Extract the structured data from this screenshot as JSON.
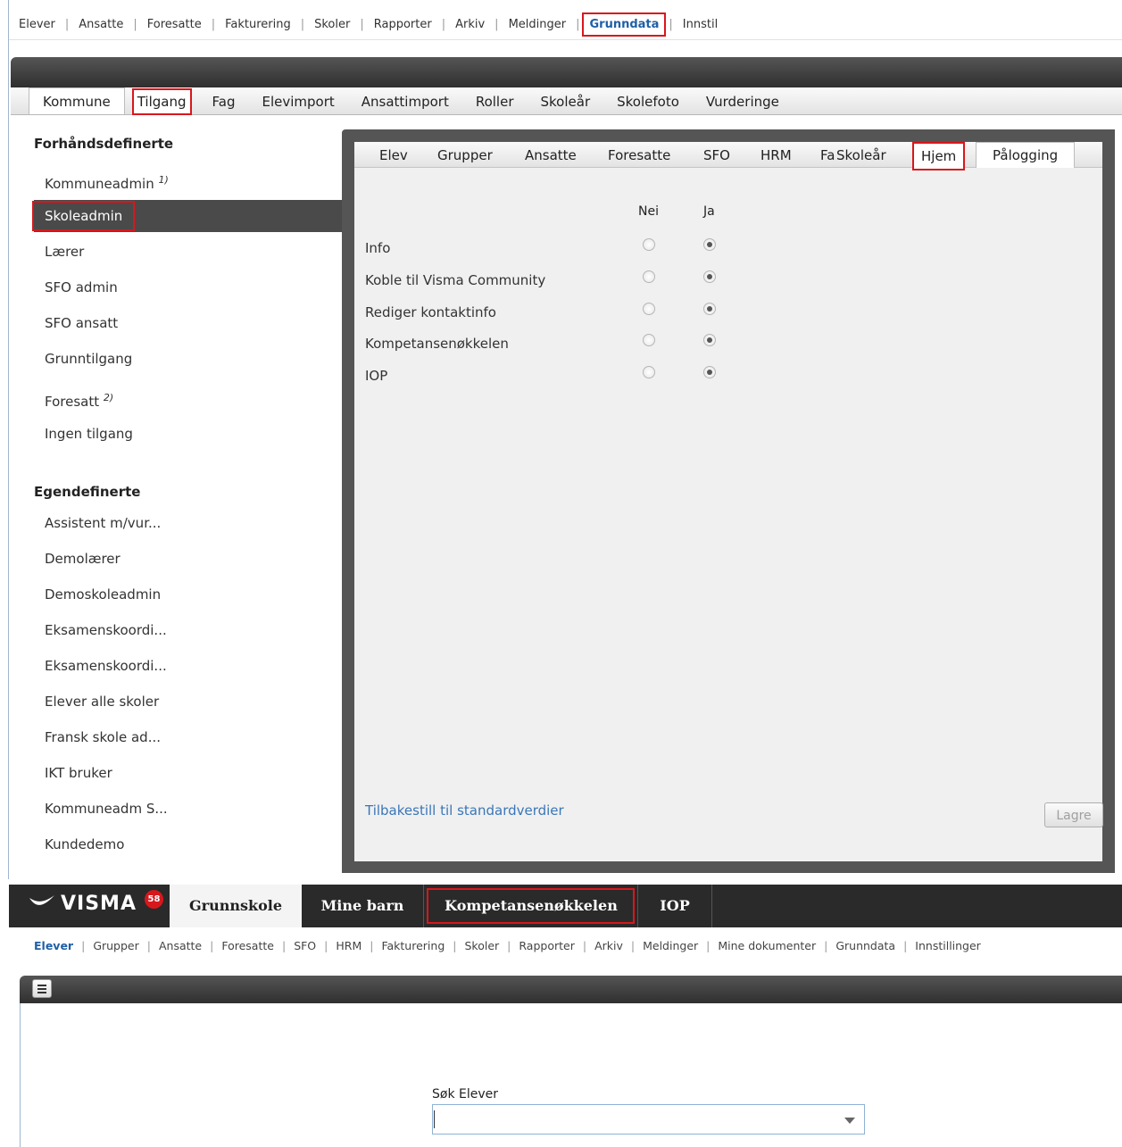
{
  "top_nav": {
    "items": [
      "Elever",
      "Ansatte",
      "Foresatte",
      "Fakturering",
      "Skoler",
      "Rapporter",
      "Arkiv",
      "Meldinger",
      "Grunndata",
      "Innstil"
    ],
    "active": "Grunndata"
  },
  "admin_tabs": {
    "items": [
      "Kommune",
      "Tilgang",
      "Fag",
      "Elevimport",
      "Ansattimport",
      "Roller",
      "Skoleår",
      "Skolefoto",
      "Vurderinge"
    ],
    "active": "Tilgang"
  },
  "roles": {
    "predefined_heading": "Forhåndsdefinerte",
    "predefined": [
      {
        "label": "Kommuneadmin",
        "note": "1)"
      },
      {
        "label": "Skoleadmin",
        "note": ""
      },
      {
        "label": "Lærer",
        "note": ""
      },
      {
        "label": "SFO admin",
        "note": ""
      },
      {
        "label": "SFO ansatt",
        "note": ""
      },
      {
        "label": "Grunntilgang",
        "note": ""
      },
      {
        "label": "Foresatt",
        "note": "2)"
      },
      {
        "label": "Ingen tilgang",
        "note": ""
      }
    ],
    "selected": "Skoleadmin",
    "custom_heading": "Egendefinerte",
    "custom": [
      "Assistent m/vur...",
      "Demolærer",
      "Demoskoleadmin",
      "Eksamenskoordi...",
      "Eksamenskoordi...",
      "Elever alle skoler",
      "Fransk skole ad...",
      "IKT bruker",
      "Kommuneadm S...",
      "Kundedemo"
    ]
  },
  "permission_tabs": {
    "items": [
      "Elev",
      "Grupper",
      "Ansatte",
      "Foresatte",
      "SFO",
      "HRM",
      "Fa",
      "Skoleår",
      "Hjem",
      "Pålogging"
    ],
    "active": "Hjem"
  },
  "permissions": {
    "col_no": "Nei",
    "col_yes": "Ja",
    "rows": [
      {
        "label": "Info",
        "value": "Ja"
      },
      {
        "label": "Koble til Visma Community",
        "value": "Ja"
      },
      {
        "label": "Rediger kontaktinfo",
        "value": "Ja"
      },
      {
        "label": "Kompetansenøkkelen",
        "value": "Ja"
      },
      {
        "label": "IOP",
        "value": "Ja"
      }
    ],
    "reset_link": "Tilbakestill til standardverdier",
    "save_label": "Lagre"
  },
  "app_bar": {
    "logo_text": "VISMA",
    "notification_count": "58",
    "tabs": [
      "Grunnskole",
      "Mine barn",
      "Kompetansenøkkelen",
      "IOP"
    ],
    "active": "Grunnskole",
    "highlighted": "Kompetansenøkkelen"
  },
  "sub_nav": {
    "items": [
      "Elever",
      "Grupper",
      "Ansatte",
      "Foresatte",
      "SFO",
      "HRM",
      "Fakturering",
      "Skoler",
      "Rapporter",
      "Arkiv",
      "Meldinger",
      "Mine dokumenter",
      "Grunndata",
      "Innstillinger"
    ],
    "active": "Elever"
  },
  "student_search": {
    "label": "Søk Elever",
    "value": ""
  },
  "colors": {
    "highlight_red": "#d8171c",
    "link_blue": "#3a76b8",
    "dark_bar": "#2f2f2f"
  }
}
